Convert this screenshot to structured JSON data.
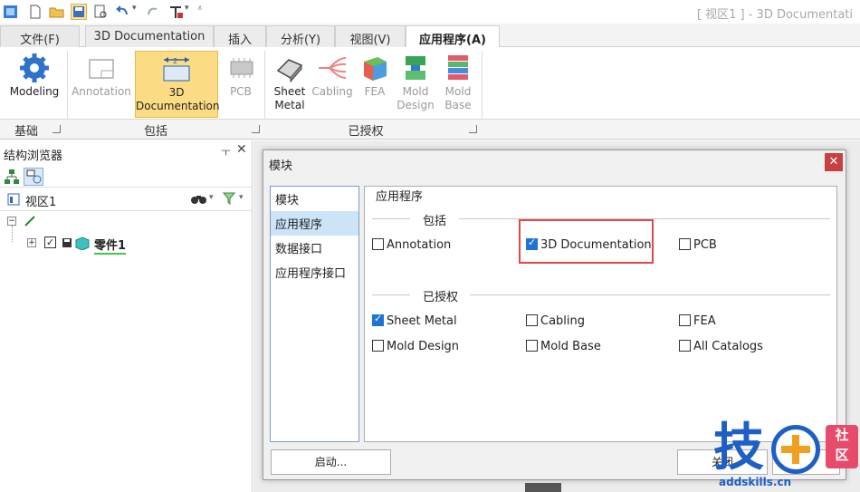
{
  "app_title": "[ 视区1 ] - 3D Documentati",
  "tabs": [
    {
      "label": "文件(F)"
    },
    {
      "label": "3D Documentation"
    },
    {
      "label": "插入"
    },
    {
      "label": "分析(Y)"
    },
    {
      "label": "视图(V)"
    },
    {
      "label": "应用程序(A)"
    }
  ],
  "ribbon": {
    "modeling": "Modeling",
    "annotation": "Annotation",
    "doc_line1": "3D",
    "doc_line2": "Documentation",
    "pcb": "PCB",
    "sheet_line1": "Sheet",
    "sheet_line2": "Metal",
    "cabling": "Cabling",
    "fea": "FEA",
    "mold_design_line1": "Mold",
    "mold_design_line2": "Design",
    "mold_base_line1": "Mold",
    "mold_base_line2": "Base",
    "group_basic": "基础",
    "group_included": "包括",
    "group_licensed": "已授权"
  },
  "browser": {
    "title": "结构浏览器",
    "pin": "ㅜ",
    "close": "✕",
    "view_label": "视区1",
    "part_label": "零件1"
  },
  "dialog": {
    "title": "模块",
    "close": "✕",
    "nav": [
      "模块",
      "应用程序",
      "数据接口",
      "应用程序接口"
    ],
    "heading": "应用程序",
    "section_included": "包括",
    "section_licensed": "已授权",
    "included": [
      {
        "label": "Annotation",
        "checked": false
      },
      {
        "label": "3D Documentation",
        "checked": true
      },
      {
        "label": "PCB",
        "checked": false
      }
    ],
    "licensed": [
      {
        "label": "Sheet Metal",
        "checked": true
      },
      {
        "label": "Cabling",
        "checked": false
      },
      {
        "label": "FEA",
        "checked": false
      },
      {
        "label": "Mold Design",
        "checked": false
      },
      {
        "label": "Mold Base",
        "checked": false
      },
      {
        "label": "All Catalogs",
        "checked": false
      }
    ],
    "start_button": "启动...",
    "close_button": "关闭"
  },
  "watermark": {
    "main": "技",
    "badge_line1": "社",
    "badge_line2": "区",
    "url": "addskills.cn"
  },
  "colors": {
    "accent": "#1e74d4",
    "selected_ribbon": "#fbdc84",
    "highlight_box": "#e04848"
  }
}
